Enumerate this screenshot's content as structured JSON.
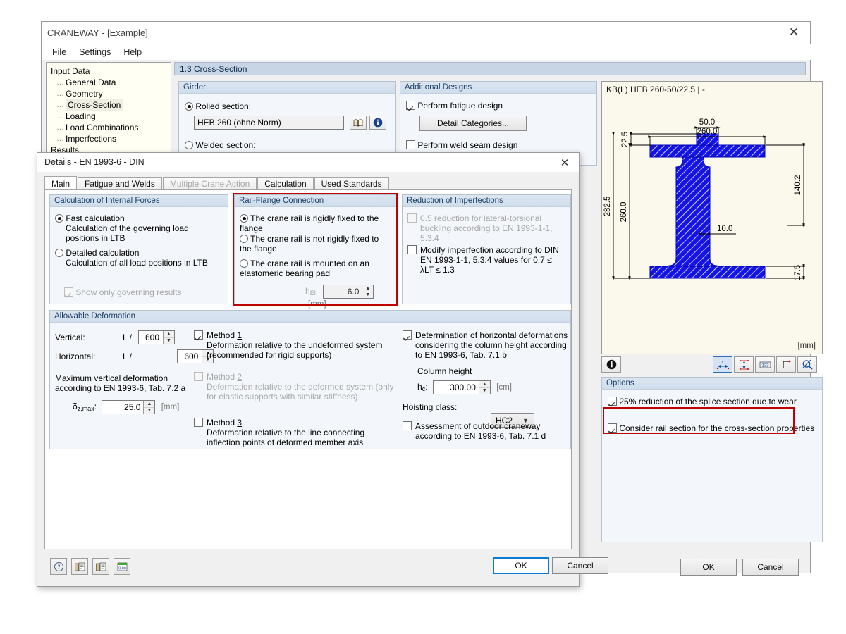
{
  "main_window": {
    "title": "CRANEWAY - [Example]",
    "close_icon": "close-icon",
    "menu": [
      "File",
      "Settings",
      "Help"
    ],
    "navigator": {
      "root": "Input Data",
      "items": [
        "General Data",
        "Geometry",
        "Cross-Section",
        "Loading",
        "Load Combinations",
        "Imperfections"
      ],
      "selected": "Cross-Section",
      "results": "Results"
    },
    "section_header": "1.3 Cross-Section",
    "girder": {
      "title": "Girder",
      "rolled_label": "Rolled section:",
      "rolled_value": "HEB 260 (ohne Norm)",
      "library_icon": "book-icon",
      "info_icon": "info-icon",
      "welded_label": "Welded section:"
    },
    "additional_designs": {
      "title": "Additional Designs",
      "fatigue_label": "Perform fatigue design",
      "fatigue_checked": true,
      "detail_categories_button": "Detail Categories...",
      "weld_label": "Perform weld seam design",
      "weld_checked": false
    },
    "cross_section_view": {
      "title": "KB(L) HEB 260-50/22.5 | -",
      "unit": "[mm]",
      "dimensions": {
        "width_total": "260.0",
        "rail_width": "50.0",
        "rail_height": "22.5",
        "overall_height": "282.5",
        "section_height": "260.0",
        "upper_dim": "140.2",
        "web_thickness": "10.0",
        "flange_thickness": "17.5"
      },
      "toolbar": {
        "info_icon": "info-icon",
        "buttons": [
          "dimension-x-icon",
          "dimension-y-icon",
          "numbers-icon",
          "axes-icon",
          "zoom-icon"
        ],
        "active": "dimension-x-icon"
      }
    },
    "options": {
      "title": "Options",
      "items": [
        {
          "label": "25% reduction of the splice section due to wear",
          "checked": true,
          "highlighted": false
        },
        {
          "label": "Consider rail section for the cross-section properties",
          "checked": true,
          "highlighted": true
        }
      ]
    },
    "buttons": {
      "ok": "OK",
      "cancel": "Cancel"
    }
  },
  "details_dialog": {
    "title": "Details - EN 1993-6 - DIN",
    "close_icon": "close-icon",
    "tabs": [
      {
        "label": "Main",
        "active": true,
        "disabled": false
      },
      {
        "label": "Fatigue and Welds",
        "active": false,
        "disabled": false
      },
      {
        "label": "Multiple Crane Action",
        "active": false,
        "disabled": true
      },
      {
        "label": "Calculation",
        "active": false,
        "disabled": false
      },
      {
        "label": "Used Standards",
        "active": false,
        "disabled": false
      }
    ],
    "internal_forces": {
      "title": "Calculation of Internal Forces",
      "options": [
        {
          "label": "Fast calculation",
          "desc": "Calculation of the governing load positions in LTB",
          "selected": true
        },
        {
          "label": "Detailed calculation",
          "desc": "Calculation of all load positions in LTB",
          "selected": false
        }
      ],
      "show_governing": {
        "label": "Show only governing results",
        "checked": true,
        "disabled": true
      }
    },
    "rail_flange": {
      "title": "Rail-Flange Connection",
      "highlighted": true,
      "options": [
        {
          "label": "The crane rail is rigidly fixed to the flange",
          "selected": true
        },
        {
          "label": "The crane rail is not rigidly fixed to the flange",
          "selected": false
        },
        {
          "label": "The crane rail is mounted on an elastomeric bearing pad",
          "selected": false
        }
      ],
      "h_label": "h",
      "h_sub": "El",
      "h_value": "6.0",
      "h_unit": "[mm]",
      "h_disabled": true
    },
    "reduction_imperfections": {
      "title": "Reduction of Imperfections",
      "items": [
        {
          "label": "0.5 reduction for lateral-torsional buckling according to EN 1993-1-1, 5.3.4",
          "checked": false,
          "disabled": true
        },
        {
          "label": "Modify imperfection according to DIN EN 1993-1-1, 5.3.4 values for 0.7 ≤ λLT ≤ 1.3",
          "checked": false,
          "disabled": false
        }
      ]
    },
    "allowable_deformation": {
      "title": "Allowable Deformation",
      "vertical_label": "Vertical:",
      "vertical_prefix": "L /",
      "vertical_value": "600",
      "horizontal_label": "Horizontal:",
      "horizontal_prefix": "L /",
      "horizontal_value": "600",
      "max_vertical_note": "Maximum vertical deformation according to EN 1993-6, Tab. 7.2 a",
      "delta_label": "δ",
      "delta_sub": "z,max",
      "delta_value": "25.0",
      "delta_unit": "[mm]",
      "methods": [
        {
          "num": "1",
          "label": "Method",
          "desc": "Deformation relative to the undeformed system (recommended for rigid supports)",
          "checked": true,
          "disabled": false
        },
        {
          "num": "2",
          "label": "Method",
          "desc": "Deformation relative to the deformed system (only for elastic supports with similar stiffness)",
          "checked": false,
          "disabled": true
        },
        {
          "num": "3",
          "label": "Method",
          "desc": "Deformation relative to the line connecting inflection points of deformed member axis",
          "checked": false,
          "disabled": false
        }
      ],
      "horizontal_determination": {
        "label": "Determination of horizontal deformations considering the column height according to EN 1993-6, Tab. 7.1 b",
        "checked": true,
        "column_height_label": "Column height",
        "hc_label": "h",
        "hc_sub": "c",
        "hc_value": "300.00",
        "hc_unit": "[cm]",
        "hoisting_label": "Hoisting class:",
        "hoisting_value": "HC2",
        "outdoor": {
          "label": "Assessment of outdoor craneway according to EN 1993-6, Tab. 7.1 d",
          "checked": false
        }
      }
    },
    "bottom_tools": [
      "help-icon",
      "load-defaults-icon",
      "save-defaults-icon",
      "units-icon"
    ],
    "buttons": {
      "ok": "OK",
      "cancel": "Cancel"
    }
  }
}
